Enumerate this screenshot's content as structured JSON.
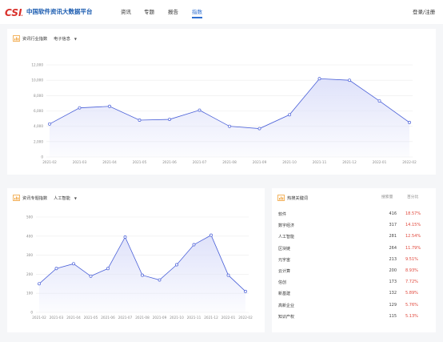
{
  "header": {
    "logo_text": "CSIA",
    "site_title": "中国软件资讯大数据平台",
    "nav": [
      {
        "label": "资讯",
        "active": false
      },
      {
        "label": "专题",
        "active": false
      },
      {
        "label": "报告",
        "active": false
      },
      {
        "label": "指数",
        "active": true
      }
    ],
    "login_label": "登录/注册"
  },
  "industry_index": {
    "title": "资讯行业指数",
    "selected": "电子信息",
    "chart_data": {
      "type": "area",
      "title": "",
      "categories": [
        "2021-02",
        "2021-03",
        "2021-04",
        "2021-05",
        "2021-06",
        "2021-07",
        "2021-08",
        "2021-09",
        "2021-10",
        "2021-11",
        "2021-12",
        "2022-01",
        "2022-02"
      ],
      "yticks": [
        "0",
        "2,000",
        "4,000",
        "6,000",
        "8,000",
        "10,000",
        "12,000"
      ],
      "ylim": [
        0,
        12000
      ],
      "series": [
        {
          "values": [
            4300,
            6400,
            6600,
            4800,
            4900,
            6100,
            4000,
            3700,
            5500,
            10200,
            10000,
            7300,
            4500
          ]
        }
      ],
      "grid": true,
      "line_color": "#4a60d8",
      "fill_color": "#dfe2fa"
    }
  },
  "topic_index": {
    "title": "资讯专题指数",
    "selected": "人工智能",
    "chart_data": {
      "type": "area",
      "title": "",
      "categories": [
        "2021-02",
        "2021-03",
        "2021-04",
        "2021-05",
        "2021-06",
        "2021-07",
        "2021-08",
        "2021-09",
        "2021-10",
        "2021-11",
        "2021-12",
        "2022-01",
        "2022-02"
      ],
      "yticks": [
        "0",
        "100",
        "200",
        "300",
        "400",
        "500"
      ],
      "ylim": [
        0,
        500
      ],
      "series": [
        {
          "values": [
            150,
            230,
            255,
            190,
            230,
            395,
            195,
            170,
            250,
            355,
            405,
            195,
            110
          ]
        }
      ],
      "grid": true,
      "line_color": "#4a60d8",
      "fill_color": "#dfe2fa"
    }
  },
  "hot_keywords": {
    "title": "热搜关键词",
    "col_count": "搜索量",
    "col_pct": "百分比",
    "rows": [
      {
        "name": "软件",
        "count": "416",
        "pct": "18.57%"
      },
      {
        "name": "数字经济",
        "count": "317",
        "pct": "14.15%"
      },
      {
        "name": "人工智能",
        "count": "281",
        "pct": "12.54%"
      },
      {
        "name": "区块链",
        "count": "264",
        "pct": "11.79%"
      },
      {
        "name": "元宇宙",
        "count": "213",
        "pct": "9.51%"
      },
      {
        "name": "云计算",
        "count": "200",
        "pct": "8.93%"
      },
      {
        "name": "信创",
        "count": "173",
        "pct": "7.72%"
      },
      {
        "name": "新基建",
        "count": "132",
        "pct": "5.89%"
      },
      {
        "name": "高新企业",
        "count": "129",
        "pct": "5.76%"
      },
      {
        "name": "知识产权",
        "count": "115",
        "pct": "5.13%"
      }
    ]
  },
  "colors": {
    "accent": "#2f6fd0",
    "brand_red": "#d9302a",
    "percent_red": "#e0463a",
    "icon_orange": "#f0a23a"
  }
}
